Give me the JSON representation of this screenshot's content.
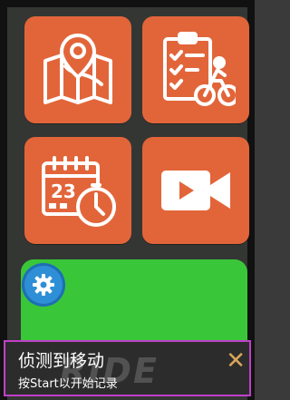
{
  "tiles": [
    {
      "name": "route-map-icon"
    },
    {
      "name": "cycling-checklist-icon"
    },
    {
      "name": "calendar-timer-icon"
    },
    {
      "name": "video-camera-icon"
    }
  ],
  "notification": {
    "title": "侦测到移动",
    "subtitle": "按Start以开始记录",
    "watermark": "RIDE",
    "close_symbol": "✕"
  },
  "colors": {
    "tile": "#e2653a",
    "start_button": "#39c739",
    "gear_button": "#2f8fd6",
    "notification_border": "#c040c8",
    "close_icon": "#d9a45a"
  }
}
